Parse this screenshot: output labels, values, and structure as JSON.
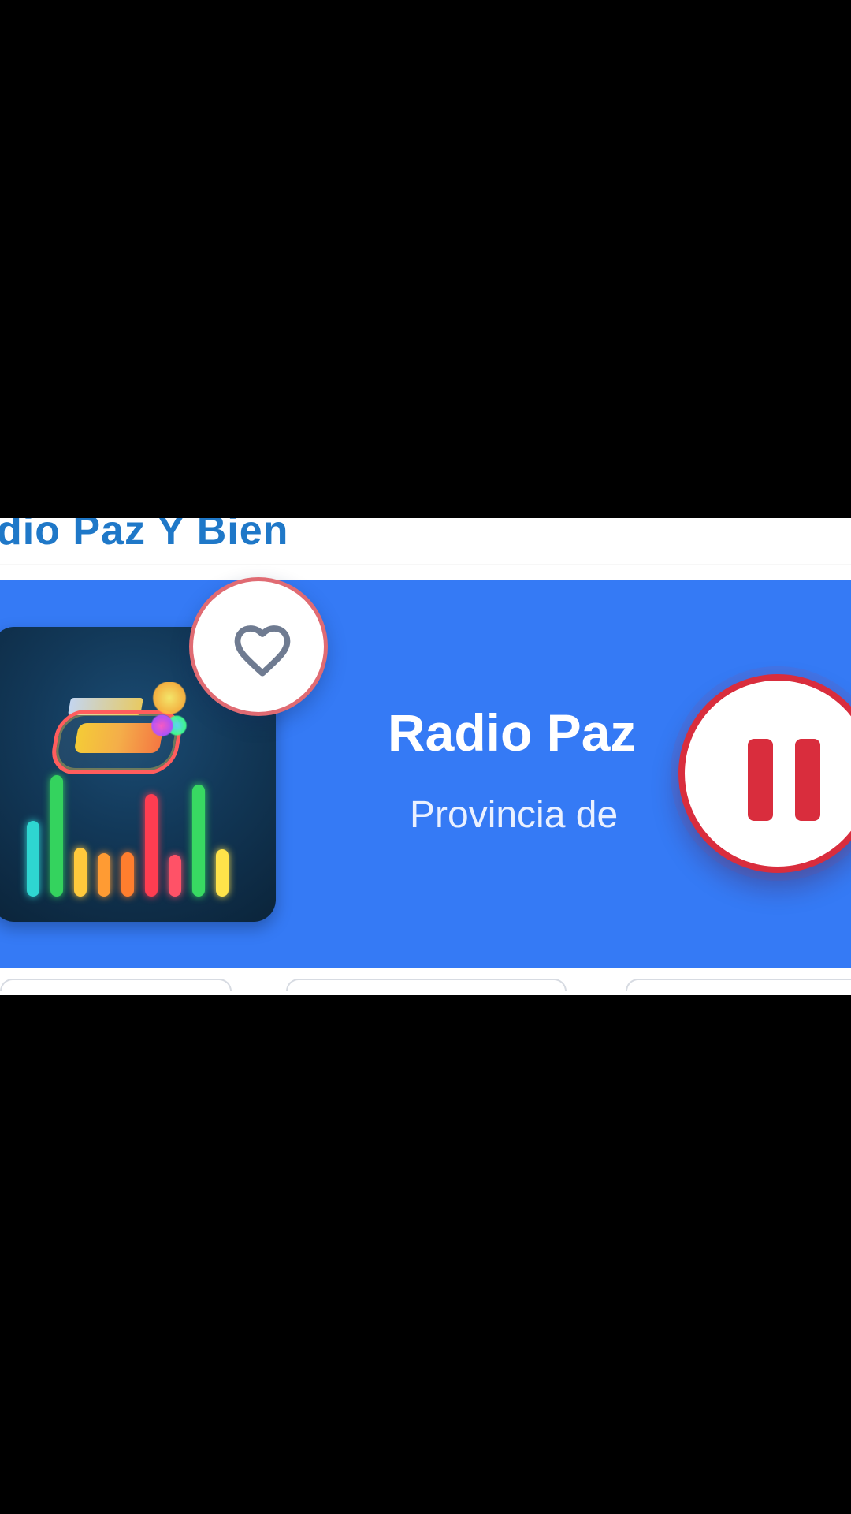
{
  "header": {
    "title": "dio Paz Y Bien"
  },
  "player": {
    "station_name": "Radio Paz",
    "location": "Provincia de",
    "favorite_icon": "heart-icon",
    "playback_icon": "pause-icon"
  },
  "colors": {
    "screen_background": "#000000",
    "content_background": "#ffffff",
    "header_text": "#1f78c8",
    "player_background": "#357af5",
    "favorite_ring": "#e06b73",
    "favorite_icon": "#6f7b91",
    "pause_ring": "#d92d3d",
    "pause_icon": "#d92d3d",
    "player_text": "#ffffff"
  }
}
